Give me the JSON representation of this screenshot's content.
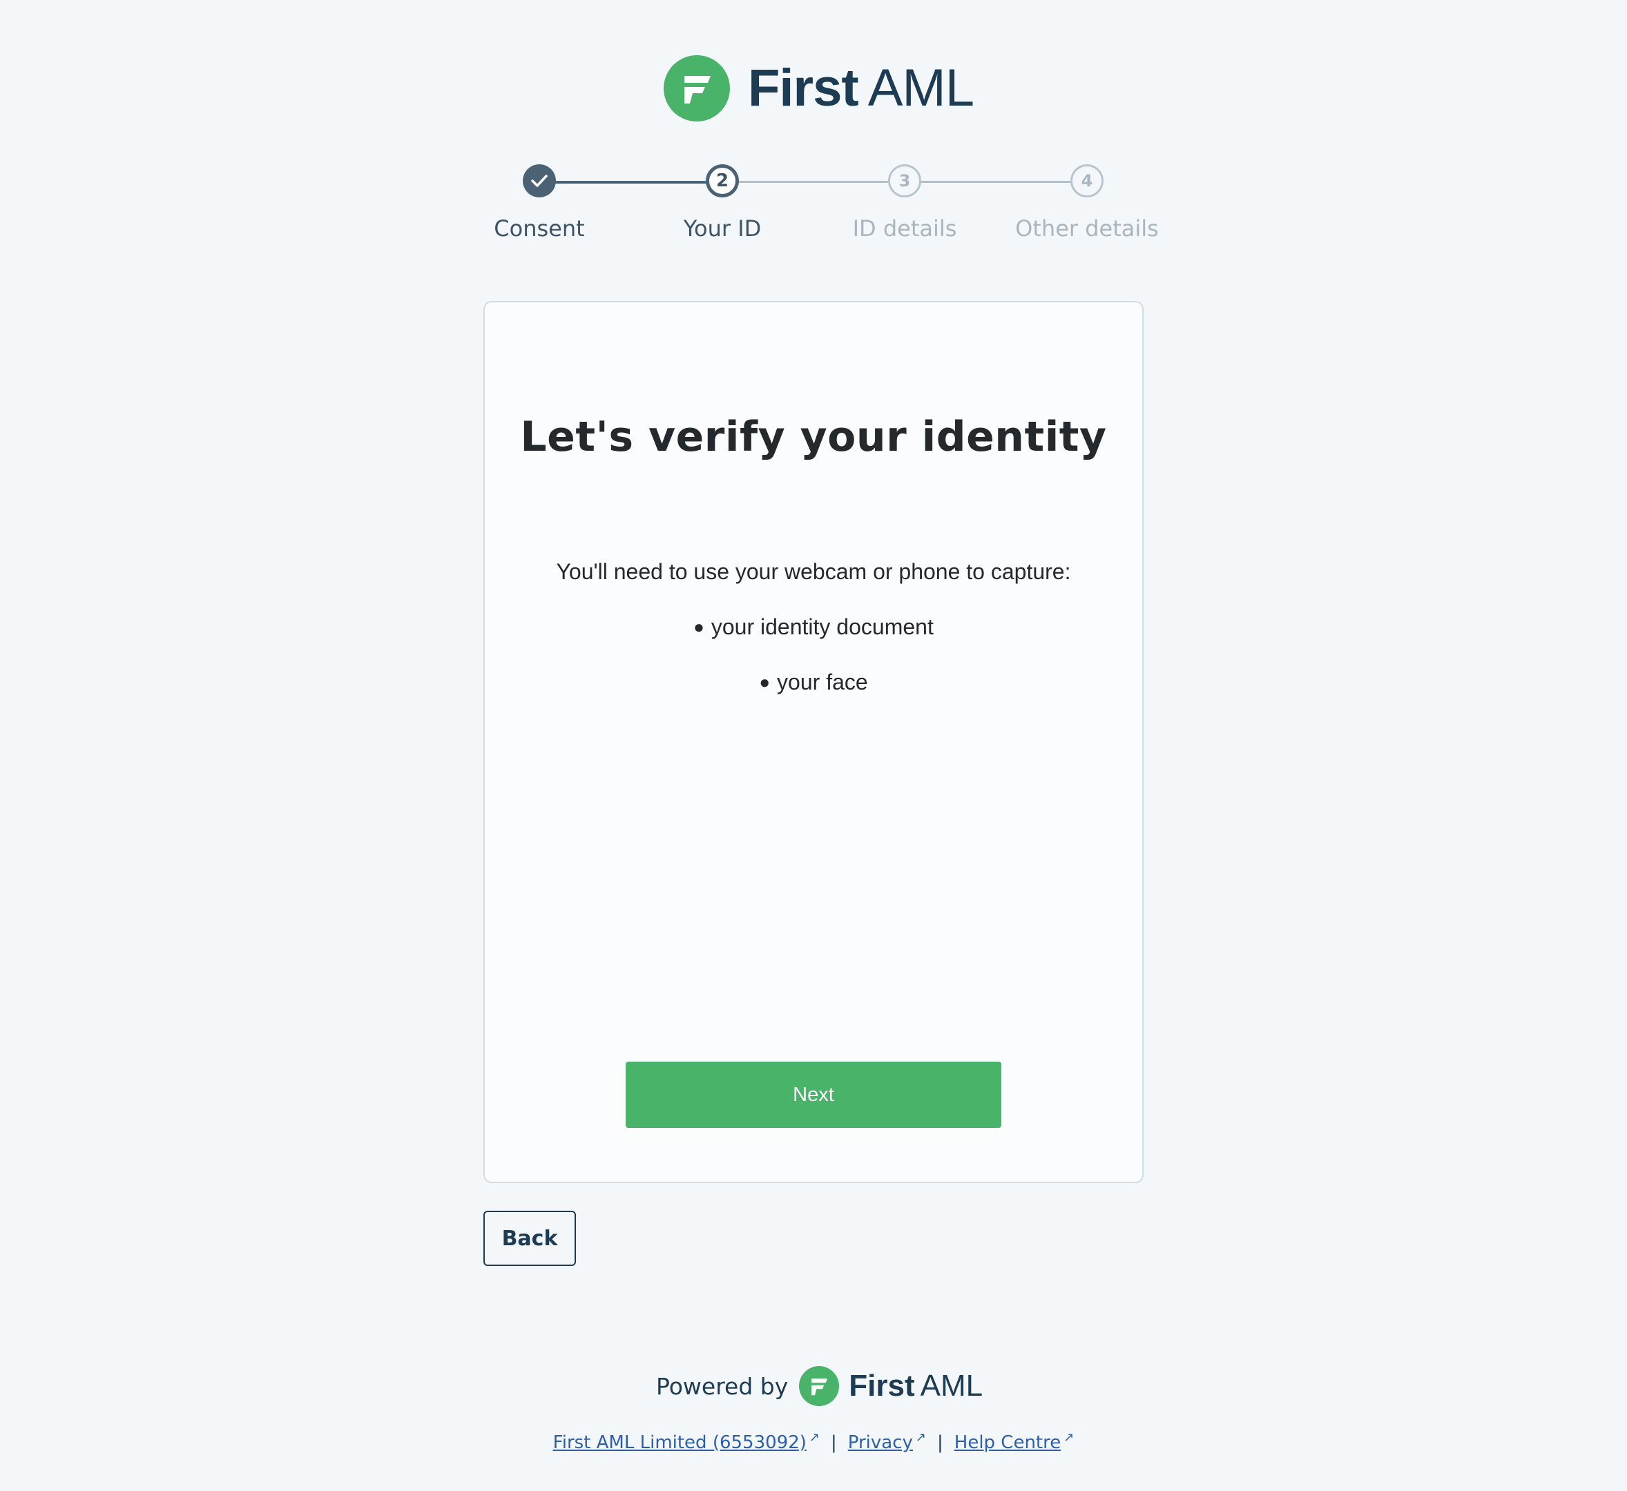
{
  "brand": {
    "name_bold": "First",
    "name_light": "AML",
    "logo_icon": "first-aml-logo-icon",
    "green": "#4ab36a",
    "navy": "#1d3b52"
  },
  "stepper": {
    "steps": [
      {
        "number": "1",
        "label": "Consent",
        "state": "completed"
      },
      {
        "number": "2",
        "label": "Your ID",
        "state": "current"
      },
      {
        "number": "3",
        "label": "ID details",
        "state": "upcoming"
      },
      {
        "number": "4",
        "label": "Other details",
        "state": "upcoming"
      }
    ]
  },
  "card": {
    "title": "Let's verify your identity",
    "intro": "You'll need to use your webcam or phone to capture:",
    "bullets": [
      "your identity document",
      "your face"
    ],
    "next_label": "Next"
  },
  "back_label": "Back",
  "footer": {
    "powered_by": "Powered by",
    "links": [
      {
        "label": "First AML Limited (6553092)"
      },
      {
        "label": "Privacy"
      },
      {
        "label": "Help Centre"
      }
    ],
    "separator": "|"
  }
}
